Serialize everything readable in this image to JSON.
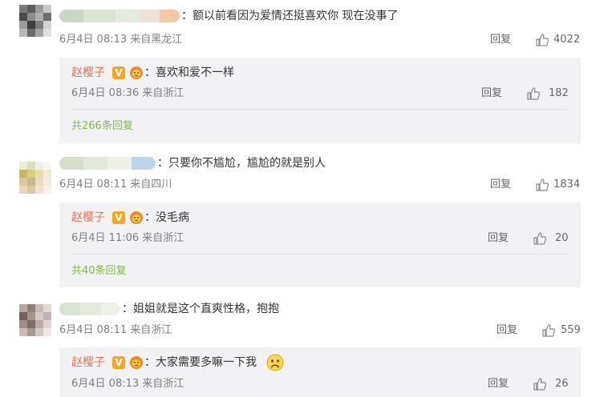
{
  "comments": [
    {
      "text": "：额以前看因为爱情还挺喜欢你 现在没事了",
      "meta": "6月4日 08:13 来自黑龙江",
      "reply_label": "回复",
      "likes": "4022",
      "reply": {
        "author": "赵樱子",
        "badge": "V",
        "text": "：喜欢和爱不一样",
        "meta": "6月4日 08:36 来自浙江",
        "reply_label": "回复",
        "likes": "182"
      },
      "more": "共266条回复"
    },
    {
      "text": "：只要你不尴尬，尴尬的就是别人",
      "meta": "6月4日 08:11 来自四川",
      "reply_label": "回复",
      "likes": "1834",
      "reply": {
        "author": "赵樱子",
        "badge": "V",
        "text": "：没毛病",
        "meta": "6月4日 11:06 来自浙江",
        "reply_label": "回复",
        "likes": "20"
      },
      "more": "共40条回复"
    },
    {
      "text": "：姐姐就是这个直爽性格，抱抱",
      "meta": "6月4日 08:11 来自浙江",
      "reply_label": "回复",
      "likes": "559",
      "reply": {
        "author": "赵樱子",
        "badge": "V",
        "text": "：大家需要多嘛一下我",
        "meta": "6月4日 08:13 来自浙江",
        "reply_label": "回复",
        "likes": "26"
      }
    }
  ],
  "icons": {
    "like": "thumbs-up-icon",
    "verified": "verified-v-icon",
    "fan_badge": "lion-fan-badge-icon",
    "sad_emoji": "sad-face-emoji"
  },
  "colors": {
    "author": "#eb7350",
    "more_link": "#7fba49",
    "reply_bg": "#f2f2f5",
    "meta": "#808080"
  }
}
